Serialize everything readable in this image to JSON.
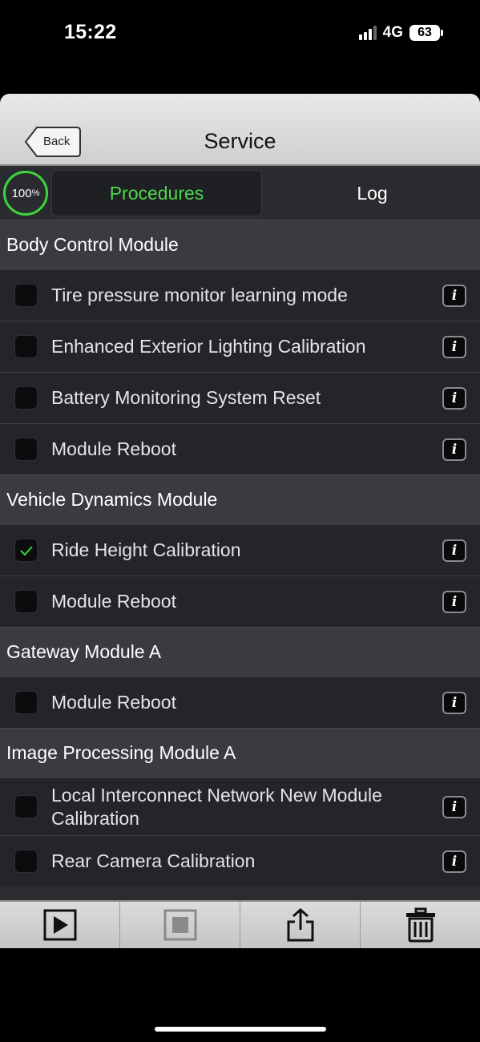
{
  "status_bar": {
    "time": "15:22",
    "network": "4G",
    "battery": "63",
    "icons": [
      "signal-icon",
      "battery-icon"
    ]
  },
  "navbar": {
    "back_label": "Back",
    "title": "Service"
  },
  "progress": {
    "value": "100",
    "unit": "%"
  },
  "tabs": {
    "procedures": "Procedures",
    "log": "Log",
    "active": "procedures"
  },
  "colors": {
    "accent_green": "#3bd63b",
    "background": "#2b2c30",
    "section_header": "#3a3b40"
  },
  "sections": [
    {
      "title": "Body Control Module",
      "items": [
        {
          "label": "Tire pressure monitor learning mode",
          "checked": false
        },
        {
          "label": "Enhanced Exterior Lighting Calibration",
          "checked": false
        },
        {
          "label": "Battery Monitoring System Reset",
          "checked": false
        },
        {
          "label": "Module Reboot",
          "checked": false
        }
      ]
    },
    {
      "title": "Vehicle Dynamics Module",
      "items": [
        {
          "label": "Ride Height Calibration",
          "checked": true
        },
        {
          "label": "Module Reboot",
          "checked": false
        }
      ]
    },
    {
      "title": "Gateway Module A",
      "items": [
        {
          "label": "Module Reboot",
          "checked": false
        }
      ]
    },
    {
      "title": "Image Processing Module A",
      "items": [
        {
          "label": "Local Interconnect Network New Module Calibration",
          "checked": false
        },
        {
          "label": "Rear Camera Calibration",
          "checked": false
        }
      ]
    }
  ],
  "toolbar": {
    "buttons": [
      "play-icon",
      "stop-icon",
      "share-icon",
      "trash-icon"
    ]
  }
}
